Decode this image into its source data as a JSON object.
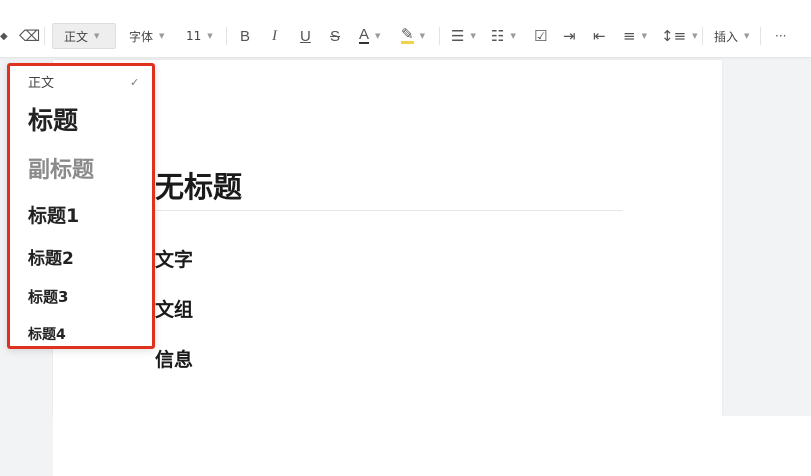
{
  "toolbar": {
    "style_value": "正文",
    "font_label": "字体",
    "size_value": "11",
    "bold": "B",
    "italic": "I",
    "underline": "U",
    "strike": "S",
    "font_color": "A",
    "insert_label": "插入",
    "more": "···"
  },
  "style_menu": {
    "items": [
      {
        "label": "正文",
        "selected": true
      },
      {
        "label": "标题"
      },
      {
        "label": "副标题"
      },
      {
        "label": "标题1"
      },
      {
        "label": "标题2"
      },
      {
        "label": "标题3"
      },
      {
        "label": "标题4"
      }
    ],
    "highlight_color": "#e0301e"
  },
  "document": {
    "title": "无标题",
    "headings": [
      "文字",
      "文组",
      "信息"
    ]
  }
}
